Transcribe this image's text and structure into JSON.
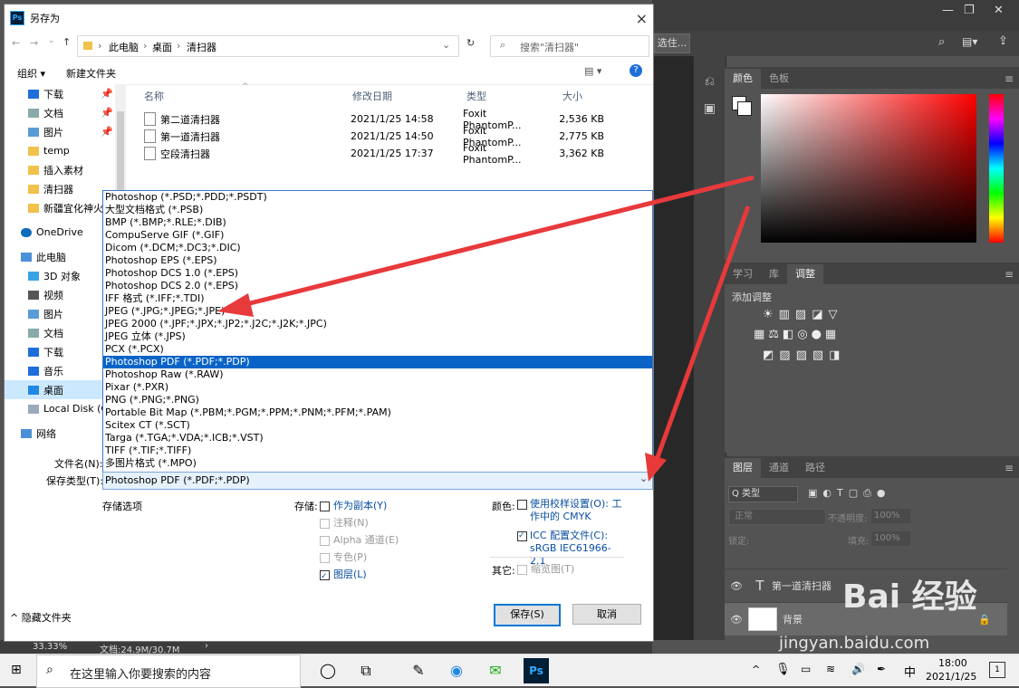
{
  "dialog": {
    "title": "另存为",
    "close": "×",
    "breadcrumb": [
      "此电脑",
      "桌面",
      "清扫器"
    ],
    "search_placeholder": "搜索\"清扫器\"",
    "toolbar": {
      "organize": "组织 ▾",
      "new_folder": "新建文件夹"
    },
    "nav_items": [
      {
        "label": "下载",
        "icon": "download-icon"
      },
      {
        "label": "文档",
        "icon": "document-icon"
      },
      {
        "label": "图片",
        "icon": "picture-icon"
      },
      {
        "label": "temp",
        "icon": "folder-icon"
      },
      {
        "label": "插入素材",
        "icon": "folder-icon"
      },
      {
        "label": "清扫器",
        "icon": "folder-icon"
      },
      {
        "label": "新疆宜化神火",
        "icon": "folder-icon"
      },
      {
        "label": "OneDrive",
        "icon": "cloud-icon"
      },
      {
        "label": "此电脑",
        "icon": "computer-icon"
      },
      {
        "label": "3D 对象",
        "icon": "3d-icon"
      },
      {
        "label": "视频",
        "icon": "video-icon"
      },
      {
        "label": "图片",
        "icon": "picture-icon"
      },
      {
        "label": "文档",
        "icon": "document-icon"
      },
      {
        "label": "下载",
        "icon": "download-icon"
      },
      {
        "label": "音乐",
        "icon": "music-icon"
      },
      {
        "label": "桌面",
        "icon": "desktop-icon"
      },
      {
        "label": "Local Disk (C",
        "icon": "disk-icon"
      },
      {
        "label": "网络",
        "icon": "network-icon"
      }
    ],
    "columns": {
      "name": "名称",
      "modified": "修改日期",
      "type": "类型",
      "size": "大小"
    },
    "files": [
      {
        "name": "第二道清扫器",
        "modified": "2021/1/25 14:58",
        "type": "Foxit PhantomP...",
        "size": "2,536 KB"
      },
      {
        "name": "第一道清扫器",
        "modified": "2021/1/25 14:50",
        "type": "Foxit PhantomP...",
        "size": "2,775 KB"
      },
      {
        "name": "空段清扫器",
        "modified": "2021/1/25 17:37",
        "type": "Foxit PhantomP...",
        "size": "3,362 KB"
      }
    ],
    "format_options": [
      "Photoshop (*.PSD;*.PDD;*.PSDT)",
      "大型文档格式 (*.PSB)",
      "BMP (*.BMP;*.RLE;*.DIB)",
      "CompuServe GIF (*.GIF)",
      "Dicom (*.DCM;*.DC3;*.DIC)",
      "Photoshop EPS (*.EPS)",
      "Photoshop DCS 1.0 (*.EPS)",
      "Photoshop DCS 2.0 (*.EPS)",
      "IFF 格式 (*.IFF;*.TDI)",
      "JPEG (*.JPG;*.JPEG;*.JPE)",
      "JPEG 2000 (*.JPF;*.JPX;*.JP2;*.J2C;*.J2K;*.JPC)",
      "JPEG 立体 (*.JPS)",
      "PCX (*.PCX)",
      "Photoshop PDF (*.PDF;*.PDP)",
      "Photoshop Raw (*.RAW)",
      "Pixar (*.PXR)",
      "PNG (*.PNG;*.PNG)",
      "Portable Bit Map (*.PBM;*.PGM;*.PPM;*.PNM;*.PFM;*.PAM)",
      "Scitex CT (*.SCT)",
      "Targa (*.TGA;*.VDA;*.ICB;*.VST)",
      "TIFF (*.TIF;*.TIFF)",
      "多图片格式 (*.MPO)"
    ],
    "selected_format_index": 13,
    "filename_label": "文件名(N):",
    "savetype_label": "保存类型(T):",
    "savetype_value": "Photoshop PDF (*.PDF;*.PDP)",
    "save_options_label": "存储选项",
    "storage_label": "存储:",
    "storage_options": [
      {
        "label": "作为副本(Y)",
        "checked": false,
        "enabled": true
      },
      {
        "label": "注释(N)",
        "checked": false,
        "enabled": false
      },
      {
        "label": "Alpha 通道(E)",
        "checked": false,
        "enabled": false
      },
      {
        "label": "专色(P)",
        "checked": false,
        "enabled": false
      },
      {
        "label": "图层(L)",
        "checked": true,
        "enabled": true
      }
    ],
    "color_label": "颜色:",
    "color_proof": "使用校样设置(O): 工作中的 CMYK",
    "icc_label": "ICC 配置文件(C): sRGB IEC61966-2.1",
    "other_label": "其它:",
    "thumbnail": "缩览图(T)",
    "hide_folders": "隐藏文件夹",
    "save_button": "保存(S)",
    "cancel_button": "取消"
  },
  "photoshop": {
    "option_btn": "选住...",
    "color_tabs": [
      "颜色",
      "色板"
    ],
    "adjust_tabs": [
      "学习",
      "库",
      "调整"
    ],
    "add_adjustment": "添加调整",
    "layer_tabs": [
      "图层",
      "通道",
      "路径"
    ],
    "kind_filter": "Q 类型",
    "blend_mode": "正常",
    "opacity_label": "不透明度:",
    "opacity_value": "100%",
    "lock_label": "锁定:",
    "fill_label": "填充:",
    "fill_value": "100%",
    "layers": [
      {
        "name": "第一道清扫器",
        "kind": "T"
      },
      {
        "name": "背景",
        "kind": "image"
      }
    ],
    "status_zoom": "33.33%",
    "status_doc": "文档:24.9M/30.7M"
  },
  "taskbar": {
    "search_text": "在这里输入你要搜索的内容",
    "ime": "中",
    "time": "18:00",
    "date": "2021/1/25",
    "notification_count": "1"
  },
  "watermark": {
    "brand": "Bai 经验",
    "url": "jingyan.baidu.com"
  },
  "colors": {
    "selection": "#0a64c8",
    "link": "#0a4ea2",
    "arrow": "#e8393b"
  }
}
